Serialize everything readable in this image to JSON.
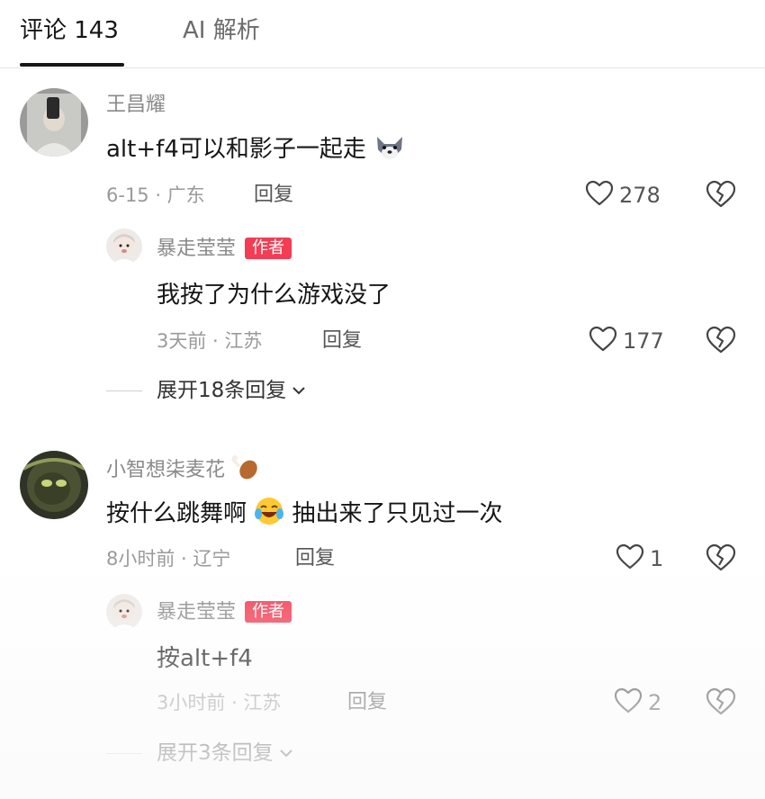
{
  "tabs": [
    {
      "label": "评论 143",
      "active": true
    },
    {
      "label": "AI 解析",
      "active": false
    }
  ],
  "comments": [
    {
      "username": "王昌耀",
      "text": "alt+f4可以和影子一起走",
      "date": "6-15 · 广东",
      "reply_label": "回复",
      "likes": "278",
      "emoji": "wolf-emoji",
      "reply": {
        "username": "暴走莹莹",
        "badge": "作者",
        "text": "我按了为什么游戏没了",
        "date": "3天前 · 江苏",
        "reply_label": "回复",
        "likes": "177"
      },
      "expand_label": "展开18条回复"
    },
    {
      "username": "小智想柒麦花",
      "text_before": "按什么跳舞啊",
      "text_after": "抽出来了只见过一次",
      "date": "8小时前 · 辽宁",
      "reply_label": "回复",
      "likes": "1",
      "reply": {
        "username": "暴走莹莹",
        "badge": "作者",
        "text": "按alt+f4",
        "date": "3小时前 · 江苏",
        "reply_label": "回复",
        "likes": "2"
      },
      "expand_label": "展开3条回复"
    }
  ],
  "icons": {
    "like": "heart-outline-icon",
    "dislike": "broken-heart-icon",
    "expand": "chevron-down-icon",
    "username_suffix": "chicken-leg-emoji",
    "laugh": "laughing-tears-emoji"
  },
  "colors": {
    "author_badge": "#f23d54",
    "meta_text": "#9a9a9a",
    "tab_underline": "#161616"
  }
}
